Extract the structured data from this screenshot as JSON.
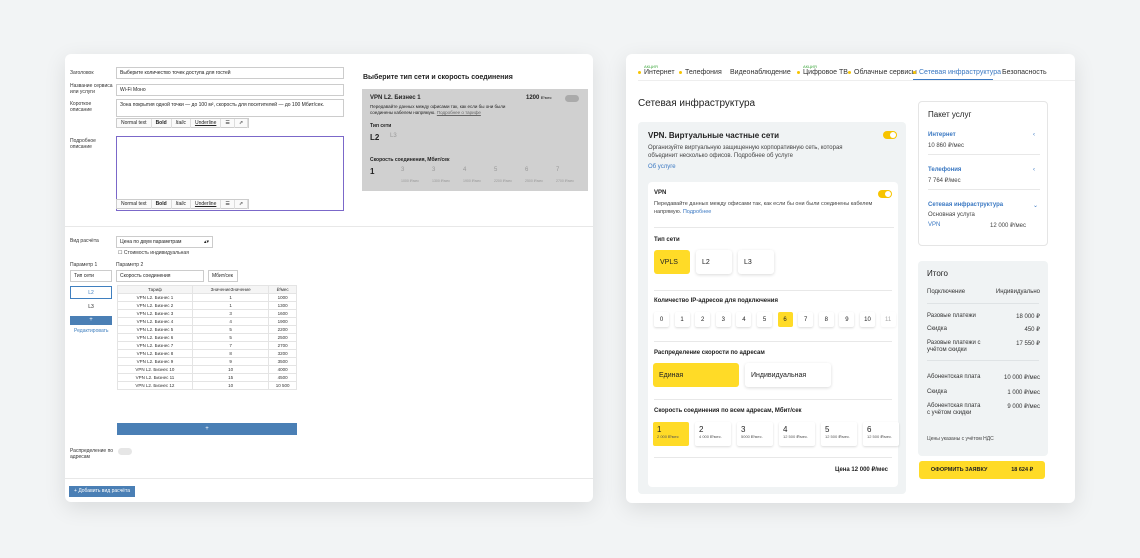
{
  "admin": {
    "title_label": "Заголовок",
    "title_value": "Выберите количество точек доступа для гостей",
    "service_label": "Название сервиса или услуги",
    "service_value": "Wi-Fi Моно",
    "short_label": "Короткое описание",
    "short_value": "Зона покрытия одной точки — до 100 м², скорость для посетителей — до 100 Мбит/сек.",
    "long_label": "Подробное описание",
    "toolbar": {
      "style": "Normal text",
      "bold": "Bold",
      "italic": "Italic",
      "underline": "Underline"
    },
    "calc_label": "Вид расчёта",
    "calc_value": "Цена по двум параметрам",
    "individual_label": "Стоимость индивидуальная",
    "param1_label": "Параметр 1",
    "param1_value": "Тип сети",
    "param2_label": "Параметр 2",
    "param2_value": "Скорость соединения",
    "param2_unit": "Мбит/сек",
    "side_items": [
      "L2",
      "L3"
    ],
    "add_label": "+",
    "edit_label": "Редактировать",
    "table_headers": [
      "Тариф",
      "ЗначениеЗначение",
      "₽/мес"
    ],
    "table_rows": [
      [
        "VPN L2. Бизнес 1",
        "1",
        "1000"
      ],
      [
        "VPN L2. Бизнес 2",
        "1",
        "1300"
      ],
      [
        "VPN L2. Бизнес 3",
        "3",
        "1600"
      ],
      [
        "VPN L2. Бизнес 4",
        "4",
        "1900"
      ],
      [
        "VPN L2. Бизнес 5",
        "5",
        "2200"
      ],
      [
        "VPN L2. Бизнес 6",
        "5",
        "2500"
      ],
      [
        "VPN L2. Бизнес 7",
        "7",
        "2700"
      ],
      [
        "VPN L2. Бизнес 8",
        "8",
        "3200"
      ],
      [
        "VPN L2. Бизнес 9",
        "9",
        "3500"
      ],
      [
        "VPN L2. Бизнес 10",
        "10",
        "4000"
      ],
      [
        "VPN L2. Бизнес 11",
        "15",
        "4500"
      ],
      [
        "VPN L2. Бизнес 12",
        "10",
        "10 500"
      ]
    ],
    "distribution_label": "Распределение по адресам",
    "add_calc": "+ Добавить вид расчёта",
    "preview": {
      "heading": "Выберите тип сети и скорость соединения",
      "name": "VPN L2. Бизнес 1",
      "price": "1200",
      "price_unit": "₽/мес",
      "desc": "Передавайте данных между офисами так, как если бы они были соединены кабелем напрямую.",
      "more": "Подробнее о тарифе",
      "type_label": "Тип сети",
      "types": [
        "L2",
        "L3"
      ],
      "speed_label": "Скорость соединения, Мбит/сек",
      "speeds": [
        [
          "1",
          ""
        ],
        [
          "3",
          "1000 ₽/мес"
        ],
        [
          "3",
          "1300 ₽/мес"
        ],
        [
          "4",
          "1900 ₽/мес"
        ],
        [
          "5",
          "2200 ₽/мес"
        ],
        [
          "6",
          "2500 ₽/мес"
        ],
        [
          "7",
          "2700 ₽/мес"
        ]
      ]
    }
  },
  "site": {
    "tabs": [
      {
        "label": "Интернет",
        "badge": "АКЦИЯ"
      },
      {
        "label": "Телефония",
        "badge": ""
      },
      {
        "label": "Видеонаблюдение",
        "badge": ""
      },
      {
        "label": "Цифровое ТВ",
        "badge": "АКЦИЯ"
      },
      {
        "label": "Облачные сервисы",
        "badge": ""
      },
      {
        "label": "Сетевая инфраструктура",
        "badge": ""
      },
      {
        "label": "Безопасность",
        "badge": ""
      }
    ],
    "page_title": "Сетевая инфраструктура",
    "vpn": {
      "title": "VPN. Виртуальные частные сети",
      "desc": "Организуйте виртуальную защищенную корпоративную сеть, которая объединит несколько офисов. Подробнее об услуге",
      "link": "Об услуге",
      "inner_title": "VPN",
      "inner_desc": "Передавайте данных между офисами так, как если бы они были соединены кабелем напрямую.",
      "inner_link": "Подробнее",
      "type_label": "Тип сети",
      "types": [
        "VPLS",
        "L2",
        "L3"
      ],
      "ip_label": "Количество IP-адресов для подключения",
      "ips": [
        "0",
        "1",
        "2",
        "3",
        "4",
        "5",
        "6",
        "7",
        "8",
        "9",
        "10",
        "11"
      ],
      "dist_label": "Распределение скорости по адресам",
      "dists": [
        "Единая",
        "Индивидуальная"
      ],
      "speed_label": "Скорость соединения по всем адресам, Мбит/сек",
      "speeds": [
        [
          "1",
          "2 000 ₽/мес"
        ],
        [
          "2",
          "4 000 ₽/мес."
        ],
        [
          "3",
          "5000 ₽/мес."
        ],
        [
          "4",
          "12 500 ₽/мес."
        ],
        [
          "5",
          "12 500 ₽/мес."
        ],
        [
          "6",
          "12 500 ₽/мес."
        ]
      ],
      "price": "Цена 12 000 ₽/мес"
    },
    "package": {
      "title": "Пакет услуг",
      "items": [
        {
          "name": "Интернет",
          "value": "10 860 ₽/мес"
        },
        {
          "name": "Телефония",
          "value": "7 764 ₽/мес"
        },
        {
          "name": "Сетевая инфраструктура",
          "value": "Основная услуга",
          "sub": "VPN",
          "sub_value": "12 000 ₽/мес"
        }
      ]
    },
    "total": {
      "title": "Итого",
      "rows": [
        [
          "Подключение",
          "Индивидуально"
        ],
        [
          "Разовые платежи",
          "18 000 ₽"
        ],
        [
          "Скидка",
          "450 ₽"
        ],
        [
          "Разовые платежи с учётом скидки",
          "17 550 ₽"
        ],
        [
          "Абонентская плата",
          "10 000 ₽/мес"
        ],
        [
          "Скидка",
          "1 000 ₽/мес"
        ],
        [
          "Абонентская плата с учётом скидки",
          "9 000 ₽/мес"
        ]
      ],
      "note": "Цены указаны с учётом НДС",
      "button": "ОФОРМИТЬ ЗАЯВКУ",
      "button_price": "18 624 ₽"
    }
  }
}
